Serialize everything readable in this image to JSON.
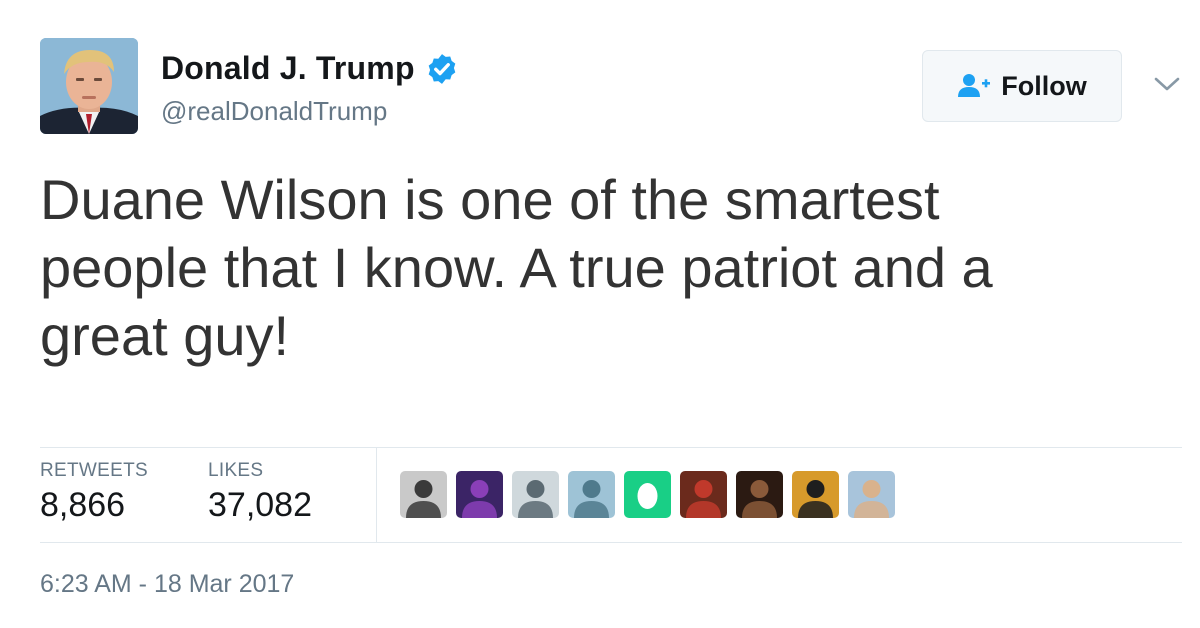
{
  "user": {
    "display_name": "Donald J. Trump",
    "handle": "@realDonaldTrump",
    "avatar_icon": "profile-photo",
    "verified_icon": "verified-badge-icon",
    "verified_color": "#1da1f2"
  },
  "follow_button": {
    "label": "Follow",
    "icon": "add-person-icon",
    "icon_color": "#1da1f2"
  },
  "menu": {
    "icon": "chevron-down-icon"
  },
  "tweet": {
    "text": "Duane Wilson is one of the smartest people that I know. A true patriot and a great guy!"
  },
  "stats": {
    "retweets_label": "RETWEETS",
    "retweets_value": "8,866",
    "likes_label": "LIKES",
    "likes_value": "37,082"
  },
  "likers": [
    {
      "icon": "liker-avatar-1",
      "colors": [
        "#c9c9c9",
        "#3a3a3a"
      ]
    },
    {
      "icon": "liker-avatar-2",
      "colors": [
        "#3b2466",
        "#8a3fb8"
      ]
    },
    {
      "icon": "liker-avatar-3",
      "colors": [
        "#cfd8dc",
        "#5b6a72"
      ]
    },
    {
      "icon": "liker-avatar-4",
      "colors": [
        "#9ec3d6",
        "#4f7a8c"
      ]
    },
    {
      "icon": "egg-avatar",
      "colors": [
        "#19cf86",
        "#ffffff"
      ]
    },
    {
      "icon": "liker-avatar-6",
      "colors": [
        "#6b2a1c",
        "#c0392b"
      ]
    },
    {
      "icon": "liker-avatar-7",
      "colors": [
        "#2b1a12",
        "#8a5a3a"
      ]
    },
    {
      "icon": "liker-avatar-8",
      "colors": [
        "#d79a2b",
        "#1e1e1e"
      ]
    },
    {
      "icon": "liker-avatar-9",
      "colors": [
        "#a8c4db",
        "#d9b28c"
      ]
    }
  ],
  "timestamp": "6:23 AM - 18 Mar 2017"
}
